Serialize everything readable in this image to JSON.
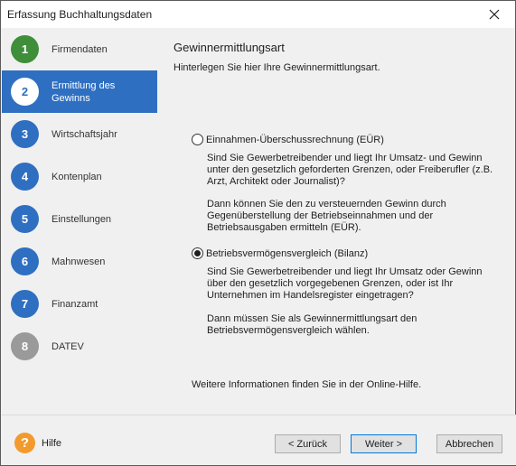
{
  "window": {
    "title": "Erfassung Buchhaltungsdaten"
  },
  "sidebar": {
    "steps": [
      {
        "number": "1",
        "label": "Firmendaten",
        "state": "done"
      },
      {
        "number": "2",
        "label": "Ermittlung des\nGewinns",
        "state": "active"
      },
      {
        "number": "3",
        "label": "Wirtschaftsjahr",
        "state": "pending"
      },
      {
        "number": "4",
        "label": "Kontenplan",
        "state": "pending"
      },
      {
        "number": "5",
        "label": "Einstellungen",
        "state": "pending"
      },
      {
        "number": "6",
        "label": "Mahnwesen",
        "state": "pending"
      },
      {
        "number": "7",
        "label": "Finanzamt",
        "state": "pending"
      },
      {
        "number": "8",
        "label": "DATEV",
        "state": "disabled"
      }
    ]
  },
  "content": {
    "heading": "Gewinnermittlungsart",
    "subheading": "Hinterlegen Sie hier Ihre Gewinnermittlungsart.",
    "option_euer": {
      "label": "Einnahmen-Überschussrechnung (EÜR)",
      "selected": false,
      "para1": "Sind Sie Gewerbetreibender und liegt Ihr Umsatz- und Gewinn unter den gesetzlich geforderten Grenzen, oder Freiberufler (z.B. Arzt, Architekt oder Journalist)?",
      "para2": "Dann können Sie den zu versteuernden Gewinn durch Gegenüberstellung der Betriebseinnahmen und der Betriebsausgaben ermitteln (EÜR)."
    },
    "option_bilanz": {
      "label": "Betriebsvermögensvergleich (Bilanz)",
      "selected": true,
      "para1": "Sind Sie Gewerbetreibender und liegt Ihr Umsatz oder Gewinn über den gesetzlich vorgegebenen Grenzen, oder ist Ihr Unternehmen im Handelsregister eingetragen?",
      "para2": "Dann müssen Sie als Gewinnermittlungsart den Betriebsvermögensvergleich wählen."
    },
    "info": "Weitere Informationen finden Sie in der Online-Hilfe."
  },
  "footer": {
    "help_label": "Hilfe",
    "help_icon_glyph": "?",
    "back_label": "< Zurück",
    "next_label": "Weiter >",
    "cancel_label": "Abbrechen"
  },
  "colors": {
    "accent": "#2f6fc1",
    "done": "#3e8e3a",
    "disabled": "#9a9a9a",
    "help": "#f29a2e"
  }
}
